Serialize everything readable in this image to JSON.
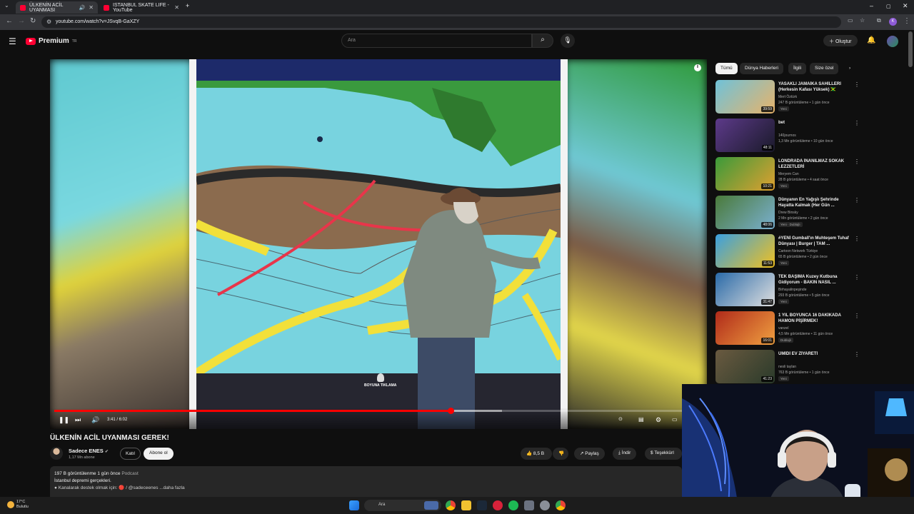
{
  "browser": {
    "tabs": [
      {
        "title": "ÜLKENİN ACİL UYANMASI",
        "active": true
      },
      {
        "title": "ISTANBUL SKATE LIFE - YouTube",
        "active": false
      }
    ],
    "url": "youtube.com/watch?v=JSvqB-GaXZY"
  },
  "masthead": {
    "logo_text": "Premium",
    "logo_region": "TR",
    "search_placeholder": "Ara",
    "create_label": "Oluştur"
  },
  "player": {
    "current_time": "3:41 / 6:02",
    "progress_fraction": 0.611,
    "buffered_fraction": 0.69,
    "watermark": "BOYUNA TIKLAMA"
  },
  "video": {
    "title": "ÜLKENİN ACİL UYANMASI GEREK!",
    "channel": "Sadece ENES",
    "subscribers": "1,17 Mn abone",
    "join_label": "Katıl",
    "subscribe_label": "Abone ol",
    "likes": "8,5 B",
    "share_label": "Paylaş",
    "download_label": "İndir",
    "thanks_label": "Teşekkürl",
    "views_date": "197 B görüntülenme  1 gün önce",
    "podcast_label": "Podcast",
    "description_line": "İstanbul depremi gerçekleri.",
    "description_more": "● Kanalarak destek olmak için: 🔴 / @sadeceenes   ...daha fazla"
  },
  "chips": [
    "Tümü",
    "Dünya Haberleri",
    "İlgili",
    "Size özel"
  ],
  "recommendations": [
    {
      "title": "YASAKLI JAMAİKA SAHİLLERİ (Herkesin Kafası Yüksek) 🇯🇲",
      "channel": "Mert Öztürk",
      "meta": "247 B görüntüleme • 1 gün önce",
      "badge": "Yeni",
      "duration": "39:59"
    },
    {
      "title": "bet",
      "channel": "140journos",
      "meta": "1,3 Mn görüntüleme • 10 gün önce",
      "badge": "",
      "duration": "48:11"
    },
    {
      "title": "LONDRADA İNANILMAZ SOKAK LEZZETLERİ",
      "channel": "Meryem Can",
      "meta": "28 B görüntüleme • 4 saat önce",
      "badge": "Yeni",
      "duration": "10:21"
    },
    {
      "title": "Dünyanın En Yağışlı Şehrinde Hayatta Kalmak (Her Gün ...",
      "channel": "Drew Binsky",
      "meta": "2 Mn görüntüleme • 2 gün önce",
      "badge": "Yeni · Dublajlı",
      "duration": "48:06"
    },
    {
      "title": "#YENİ Gumball'ın Muhteşem Tuhaf Dünyası | Burger | TAM ...",
      "channel": "Cartoon Network Türkiye",
      "meta": "65 B görüntüleme • 2 gün önce",
      "badge": "Yeni",
      "duration": "11:53"
    },
    {
      "title": "TEK BAŞIMA Kuzey Kutbuna Gidiyorum - BAKIN NASIL ...",
      "channel": "Birhayalinpeşinde",
      "meta": "293 B görüntüleme • 5 gün önce",
      "badge": "Yeni",
      "duration": "31:47"
    },
    {
      "title": "1 YIL BOYUNCA 16 DAKİKADA HAMON PİŞİRMEK!",
      "channel": "vanzel",
      "meta": "4,5 Mn görüntüleme • 11 gün önce",
      "badge": "Dublajlı",
      "duration": "16:01"
    },
    {
      "title": "ÜMİDİ EV ZİYARETİ",
      "channel": "nesli taylan",
      "meta": "763 B görüntüleme • 1 gün önce",
      "badge": "Yeni",
      "duration": "41:23"
    }
  ],
  "taskbar": {
    "temp": "17°C",
    "weather": "Bulutlu",
    "search_label": "Ara"
  }
}
